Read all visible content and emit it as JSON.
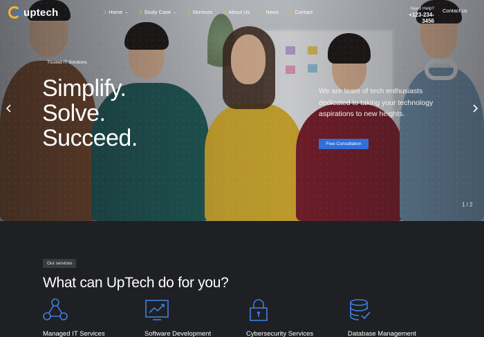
{
  "logo": {
    "name": "uptech"
  },
  "nav": {
    "items": [
      {
        "num": "1",
        "label": "Home",
        "caret": "⌄"
      },
      {
        "num": "2",
        "label": "Study Case",
        "caret": "⌄"
      },
      {
        "num": "3",
        "label": "Services",
        "caret": ""
      },
      {
        "num": "4",
        "label": "About Us",
        "caret": ""
      },
      {
        "num": "5",
        "label": "News",
        "caret": ""
      },
      {
        "num": "6",
        "label": "Contact",
        "caret": ""
      }
    ],
    "need_help": "Need Help?",
    "phone": "+123-234-3456",
    "contact_button": "Contact us"
  },
  "hero": {
    "eyebrow": "Trusted IT Solutions",
    "headline": [
      "Simplify.",
      "Solve.",
      "Succeed."
    ],
    "tagline": "We are team of tech enthusiasts dedicated to taking your technology aspirations to new heights.",
    "cta": "Free Consultation",
    "prev_icon": "chevron-left-icon",
    "next_icon": "chevron-right-icon",
    "slide_current": "1",
    "slide_total": "2"
  },
  "services": {
    "badge": "Our services",
    "title": "What can UpTech do for you?",
    "items": [
      {
        "label": "Managed IT Services",
        "icon": "network-nodes-icon"
      },
      {
        "label": "Software Development",
        "icon": "chart-monitor-icon"
      },
      {
        "label": "Cybersecurity Services",
        "icon": "padlock-icon"
      },
      {
        "label": "Database Management",
        "icon": "database-check-icon"
      }
    ]
  },
  "colors": {
    "accent": "#f2b632",
    "primary": "#2f6fdc",
    "dark_bg": "#1f2024"
  }
}
